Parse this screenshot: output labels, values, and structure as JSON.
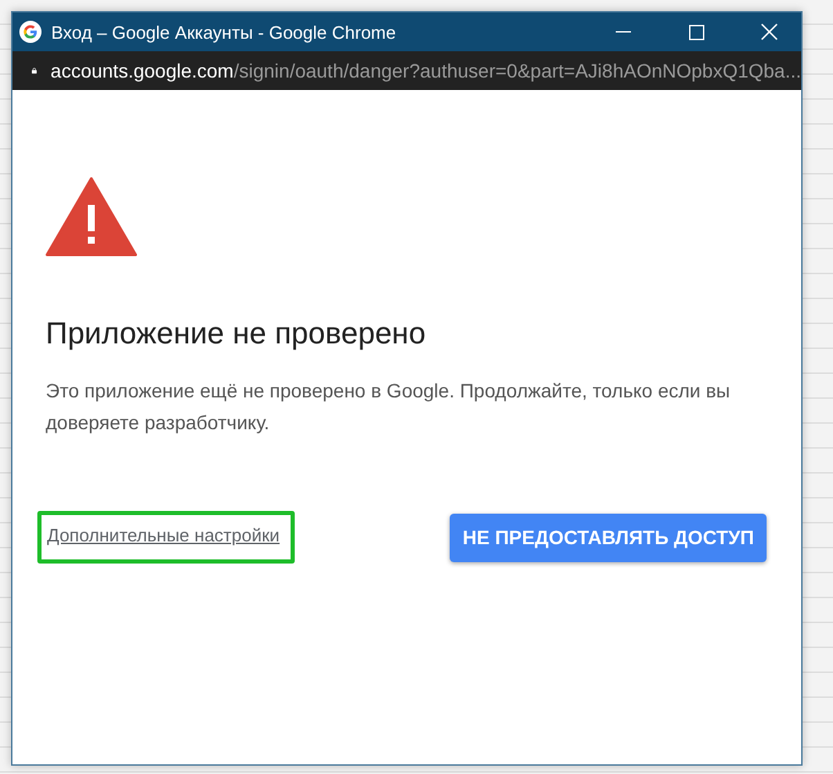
{
  "window": {
    "title": "Вход – Google Аккаунты - Google Chrome"
  },
  "address_bar": {
    "host": "accounts.google.com",
    "path": "/signin/oauth/danger?authuser=0&part=AJi8hAOnNOpbxQ1Qba..."
  },
  "warning": {
    "heading": "Приложение не проверено",
    "message": "Это приложение ещё не проверено в Google. Продолжайте, только если вы доверяете разработчику."
  },
  "advanced_link": {
    "label": "Дополнительные настройки",
    "highlighted": true
  },
  "deny_button": {
    "label": "НЕ ПРЕДОСТАВЛЯТЬ ДОСТУП"
  }
}
